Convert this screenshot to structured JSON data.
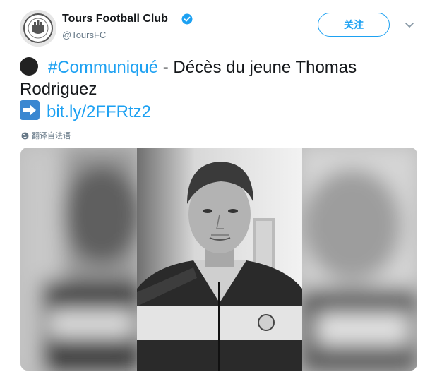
{
  "header": {
    "display_name": "Tours Football Club",
    "handle": "@ToursFC",
    "follow_label": "关注",
    "verified": true
  },
  "tweet": {
    "line1_hashtag": "#Communiqué",
    "line1_text": " - Décès du jeune Thomas",
    "line2_text": "Rodriguez",
    "link_text": "bit.ly/2FFRtz2",
    "translate_label": "翻译自法语"
  },
  "icons": {
    "verified": "verified-badge-icon",
    "caret": "chevron-down-icon",
    "bullet": "black-circle-emoji",
    "arrow": "right-arrow-emoji",
    "globe": "globe-icon"
  },
  "colors": {
    "link": "#1da1f2",
    "text": "#14171a",
    "muted": "#657786",
    "arrow_box": "#3a87d1"
  }
}
